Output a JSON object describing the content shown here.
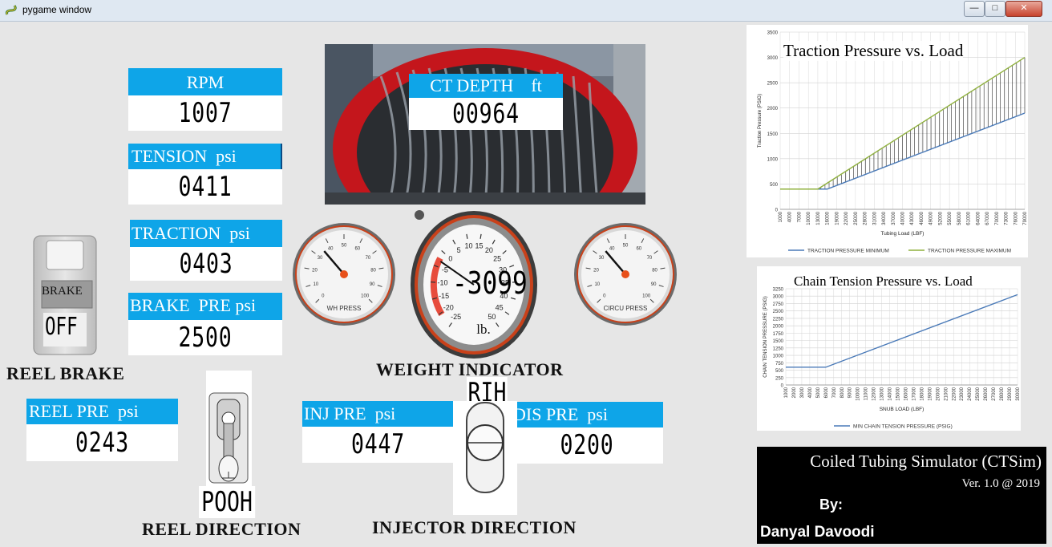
{
  "window": {
    "title": "pygame window",
    "minimize": "—",
    "maximize": "□",
    "close": "✕"
  },
  "icons": {
    "app": "pygame-snake-icon",
    "reel": "coiled-tubing-reel-photo",
    "brake_switch": "brake-push-button",
    "reel_lever": "reel-direction-lever",
    "injector_lever": "injector-direction-lever"
  },
  "colors": {
    "header": "#0ea5e8",
    "needle": "#e8501a",
    "gauge_rim": "#c9411a",
    "min_series": "#4a7ab8",
    "max_series": "#8fb03e",
    "credit_bg": "#000000"
  },
  "panels": {
    "rpm": {
      "label": "RPM",
      "value": "1007"
    },
    "tension": {
      "label": "TENSION  psi",
      "value": "0411"
    },
    "traction": {
      "label": "TRACTION  psi",
      "value": "0403"
    },
    "brake_pre": {
      "label": "BRAKE  PRE psi",
      "value": "2500"
    },
    "ct_depth": {
      "label": "CT DEPTH    ft",
      "value": "00964"
    },
    "reel_pre": {
      "label": "REEL PRE  psi",
      "value": "0243"
    },
    "inj_pre": {
      "label": "INJ PRE  psi",
      "value": "0447"
    },
    "dis_pre": {
      "label": "DIS PRE  psi",
      "value": "0200"
    }
  },
  "brake": {
    "button_label": "BRAKE",
    "state": "OFF",
    "caption": "REEL BRAKE"
  },
  "reel_direction": {
    "state": "POOH",
    "caption": "REEL DIRECTION"
  },
  "injector_direction": {
    "state": "RIH",
    "caption": "INJECTOR DIRECTION"
  },
  "gauges": {
    "wh": {
      "label": "WH PRESS",
      "ticks": [
        "0",
        "10",
        "20",
        "30",
        "40",
        "50",
        "60",
        "70",
        "80",
        "90",
        "100"
      ],
      "value": 35
    },
    "circu": {
      "label": "CIRCU PRESS",
      "ticks": [
        "0",
        "10",
        "20",
        "30",
        "40",
        "50",
        "60",
        "70",
        "80",
        "90",
        "100"
      ],
      "value": 35
    },
    "weight": {
      "caption": "WEIGHT INDICATOR",
      "readout": "-3099",
      "unit": "lb.",
      "ticks": [
        "-25",
        "-20",
        "-15",
        "-10",
        "-5",
        "0",
        "5",
        "10",
        "15",
        "20",
        "25",
        "30",
        "35",
        "40",
        "45",
        "50"
      ],
      "needle_value": -3
    }
  },
  "credit": {
    "title": "Coiled Tubing Simulator (CTSim)",
    "version": "Ver. 1.0 @ 2019",
    "by": "By:",
    "author": "Danyal Davoodi"
  },
  "chart_data": [
    {
      "type": "line",
      "title": "Traction Pressure vs. Load",
      "xlabel": "Tubing Load (LBF)",
      "ylabel": "Traction Pressure (PSIG)",
      "x_ticks": [
        "1000",
        "4000",
        "7000",
        "10000",
        "13000",
        "16000",
        "19000",
        "22000",
        "25000",
        "28000",
        "31000",
        "34000",
        "37000",
        "40000",
        "43000",
        "46000",
        "49000",
        "52000",
        "55000",
        "58000",
        "61000",
        "64000",
        "67000",
        "70000",
        "73000",
        "76000",
        "79000"
      ],
      "y_ticks": [
        0,
        500,
        1000,
        1500,
        2000,
        2500,
        3000,
        3500
      ],
      "ylim": [
        0,
        3500
      ],
      "xlim": [
        1000,
        79000
      ],
      "grid": true,
      "hatch_between_series": true,
      "legend_position": "bottom",
      "series": [
        {
          "name": "TRACTION PRESSURE MINIMUM",
          "x": [
            1000,
            16000,
            79000
          ],
          "y": [
            400,
            400,
            1900
          ]
        },
        {
          "name": "TRACTION PRESSURE MAXIMUM",
          "x": [
            1000,
            13000,
            79000
          ],
          "y": [
            400,
            400,
            3000
          ]
        }
      ]
    },
    {
      "type": "line",
      "title": "Chain Tension Pressure vs. Load",
      "xlabel": "SNUB LOAD (LBF)",
      "ylabel": "CHAIN TENSION PRESSURE (PSIG)",
      "x_ticks": [
        "1000",
        "2000",
        "3000",
        "4000",
        "5000",
        "6000",
        "7000",
        "8000",
        "9000",
        "10000",
        "11000",
        "12000",
        "13000",
        "14000",
        "15000",
        "16000",
        "17000",
        "18000",
        "19000",
        "20000",
        "21000",
        "22000",
        "23000",
        "24000",
        "25000",
        "26000",
        "27000",
        "28000",
        "29000",
        "30000"
      ],
      "y_ticks": [
        0,
        250,
        500,
        750,
        1000,
        1250,
        1500,
        1750,
        2000,
        2250,
        2500,
        2750,
        3000,
        3250
      ],
      "ylim": [
        0,
        3250
      ],
      "xlim": [
        1000,
        30000
      ],
      "grid": true,
      "legend_position": "bottom",
      "series": [
        {
          "name": "MIN CHAIN TENSION PRESSURE (PSIG)",
          "x": [
            1000,
            6000,
            30000
          ],
          "y": [
            600,
            600,
            3050
          ]
        }
      ]
    }
  ]
}
